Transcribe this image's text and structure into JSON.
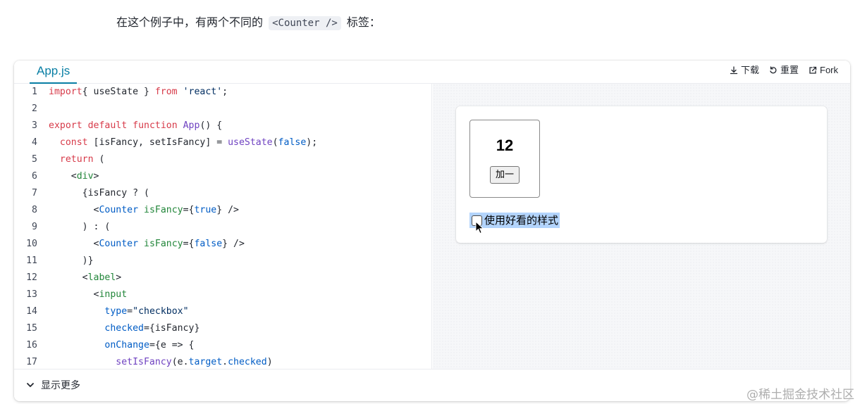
{
  "intro": {
    "before": "在这个例子中，有两个不同的",
    "code": "<Counter />",
    "after": "标签："
  },
  "tab": {
    "label": "App.js"
  },
  "actions": {
    "download": "下载",
    "reset": "重置",
    "fork": "Fork"
  },
  "code_lines": [
    {
      "n": "1",
      "parts": [
        [
          "kw",
          "import"
        ],
        [
          "",
          "{ useState } "
        ],
        [
          "kw",
          "from"
        ],
        [
          "",
          " "
        ],
        [
          "st",
          "'react'"
        ],
        [
          "",
          ";"
        ]
      ]
    },
    {
      "n": "2",
      "parts": [
        [
          "",
          ""
        ]
      ]
    },
    {
      "n": "3",
      "parts": [
        [
          "kw",
          "export"
        ],
        [
          "",
          " "
        ],
        [
          "kw",
          "default"
        ],
        [
          "",
          " "
        ],
        [
          "kw",
          "function"
        ],
        [
          "",
          " "
        ],
        [
          "fn",
          "App"
        ],
        [
          "",
          "() {"
        ]
      ]
    },
    {
      "n": "4",
      "parts": [
        [
          "",
          "  "
        ],
        [
          "kw",
          "const"
        ],
        [
          "",
          " [isFancy, setIsFancy] = "
        ],
        [
          "fn",
          "useState"
        ],
        [
          "",
          "("
        ],
        [
          "at",
          "false"
        ],
        [
          "",
          ");"
        ]
      ]
    },
    {
      "n": "5",
      "parts": [
        [
          "",
          "  "
        ],
        [
          "kw",
          "return"
        ],
        [
          "",
          " ("
        ]
      ]
    },
    {
      "n": "6",
      "parts": [
        [
          "",
          "    <"
        ],
        [
          "tg",
          "div"
        ],
        [
          "",
          ">"
        ]
      ]
    },
    {
      "n": "7",
      "parts": [
        [
          "",
          "      {isFancy ? ("
        ]
      ]
    },
    {
      "n": "8",
      "parts": [
        [
          "",
          "        <"
        ],
        [
          "at",
          "Counter"
        ],
        [
          "",
          " "
        ],
        [
          "tg",
          "isFancy"
        ],
        [
          "",
          "={"
        ],
        [
          "at",
          "true"
        ],
        [
          "",
          "} />"
        ]
      ]
    },
    {
      "n": "9",
      "parts": [
        [
          "",
          "      ) : ("
        ]
      ]
    },
    {
      "n": "10",
      "parts": [
        [
          "",
          "        <"
        ],
        [
          "at",
          "Counter"
        ],
        [
          "",
          " "
        ],
        [
          "tg",
          "isFancy"
        ],
        [
          "",
          "={"
        ],
        [
          "at",
          "false"
        ],
        [
          "",
          "} />"
        ]
      ]
    },
    {
      "n": "11",
      "parts": [
        [
          "",
          "      )}"
        ]
      ]
    },
    {
      "n": "12",
      "parts": [
        [
          "",
          "      <"
        ],
        [
          "tg",
          "label"
        ],
        [
          "",
          ">"
        ]
      ]
    },
    {
      "n": "13",
      "parts": [
        [
          "",
          "        <"
        ],
        [
          "tg",
          "input"
        ]
      ]
    },
    {
      "n": "14",
      "parts": [
        [
          "",
          "          "
        ],
        [
          "at",
          "type"
        ],
        [
          "",
          "="
        ],
        [
          "st",
          "\"checkbox\""
        ]
      ]
    },
    {
      "n": "15",
      "parts": [
        [
          "",
          "          "
        ],
        [
          "at",
          "checked"
        ],
        [
          "",
          "={isFancy}"
        ]
      ]
    },
    {
      "n": "16",
      "parts": [
        [
          "",
          "          "
        ],
        [
          "at",
          "onChange"
        ],
        [
          "",
          "={e => {"
        ]
      ]
    },
    {
      "n": "17",
      "parts": [
        [
          "",
          "            "
        ],
        [
          "fn",
          "setIsFancy"
        ],
        [
          "",
          "(e."
        ],
        [
          "at",
          "target"
        ],
        [
          "",
          "."
        ],
        [
          "at",
          "checked"
        ],
        [
          "",
          ")"
        ]
      ]
    }
  ],
  "preview": {
    "count": "12",
    "increment_label": "加一",
    "checkbox_label": "使用好看的样式",
    "checkbox_checked": false
  },
  "footer": {
    "show_more": "显示更多"
  },
  "watermark": "@稀土掘金技术社区",
  "colors": {
    "accent": "#087ea4",
    "selection": "#b3d4fc"
  }
}
